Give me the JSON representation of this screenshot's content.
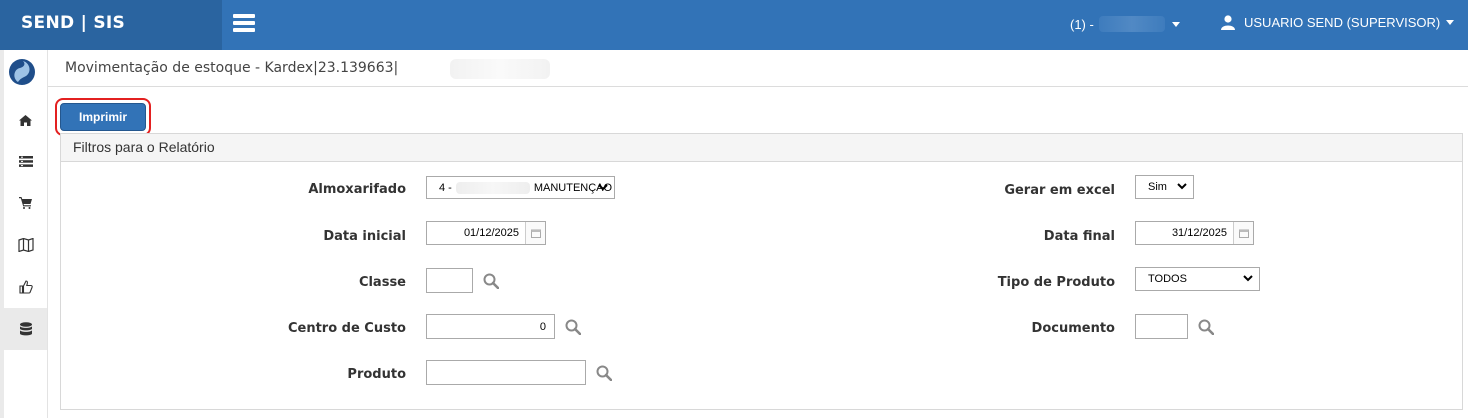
{
  "app": {
    "brand": "SEND | SIS"
  },
  "topbar": {
    "unit_prefix": "(1) -",
    "user_name": "USUARIO SEND (SUPERVISOR)"
  },
  "sidebar": {
    "items": [
      {
        "icon": "home-icon"
      },
      {
        "icon": "list-icon"
      },
      {
        "icon": "cart-icon"
      },
      {
        "icon": "map-icon"
      },
      {
        "icon": "thumbs-up-icon"
      },
      {
        "icon": "database-icon",
        "active": true
      }
    ]
  },
  "page": {
    "title": "Movimentação de estoque - Kardex|23.139663|"
  },
  "toolbar": {
    "print_label": "Imprimir"
  },
  "filters": {
    "title": "Filtros para o Relatório",
    "almoxarifado": {
      "label": "Almoxarifado",
      "prefix": "4 -",
      "suffix": "MANUTENÇAO"
    },
    "data_inicial": {
      "label": "Data inicial",
      "value": "01/12/2025"
    },
    "classe": {
      "label": "Classe",
      "value": ""
    },
    "centro_custo": {
      "label": "Centro de Custo",
      "value": "0"
    },
    "produto": {
      "label": "Produto",
      "value": ""
    },
    "gerar_excel": {
      "label": "Gerar em excel",
      "value": "Sim"
    },
    "data_final": {
      "label": "Data final",
      "value": "31/12/2025"
    },
    "tipo_produto": {
      "label": "Tipo de Produto",
      "value": "TODOS"
    },
    "documento": {
      "label": "Documento",
      "value": ""
    }
  },
  "colors": {
    "primary": "#3273b7",
    "brand_bg": "#2a64a0",
    "highlight": "#e32020"
  }
}
